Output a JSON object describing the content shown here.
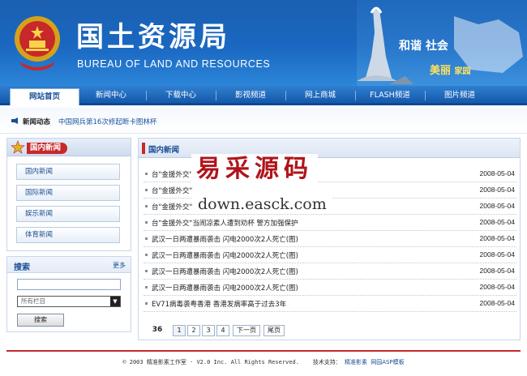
{
  "header": {
    "title_cn": "国土资源局",
    "title_en": "BUREAU OF LAND AND RESOURCES",
    "slogan": {
      "w1": "和谐",
      "w2": "社会",
      "w3": "美丽",
      "w4": "家园"
    }
  },
  "nav": {
    "items": [
      {
        "label": "网站首页",
        "active": true
      },
      {
        "label": "新闻中心"
      },
      {
        "label": "下载中心"
      },
      {
        "label": "影视频道"
      },
      {
        "label": "网上商城"
      },
      {
        "label": "FLASH频道"
      },
      {
        "label": "图片频道"
      }
    ]
  },
  "ticker": {
    "label": "新闻动态",
    "text": "中国网兵第16次修起断卡图林杯"
  },
  "sidebar": {
    "header": "国内新闻",
    "items": [
      "国内新闻",
      "国际新闻",
      "娱乐新闻",
      "体育新闻"
    ]
  },
  "search": {
    "title": "搜索",
    "more": "更多",
    "select_value": "所有栏目",
    "button": "搜索"
  },
  "main": {
    "header": "国内新闻",
    "rows": [
      {
        "title": "台\"金援外交\"",
        "date": "2008-05-04"
      },
      {
        "title": "台\"金援外交\"",
        "date": "2008-05-04"
      },
      {
        "title": "台\"金援外交\"",
        "date": "2008-05-04"
      },
      {
        "title": "台\"金援外交\"当闹凉素人遭到劝杯 警方加强保护",
        "date": "2008-05-04"
      },
      {
        "title": "武汉一日两遭暴雨袭击 闪电2000次2人死亡(图)",
        "date": "2008-05-04"
      },
      {
        "title": "武汉一日两遭暴雨袭击 闪电2000次2人死亡(图)",
        "date": "2008-05-04"
      },
      {
        "title": "武汉一日两遭暴雨袭击 闪电2000次2人死亡(图)",
        "date": "2008-05-04"
      },
      {
        "title": "武汉一日两遭暴雨袭击 闪电2000次2人死亡(图)",
        "date": "2008-05-04"
      },
      {
        "title": "EV71病毒袭粤香港 香港发病率高于过去3年",
        "date": "2008-05-04"
      }
    ],
    "pager": {
      "total": "36",
      "pages": [
        "1",
        "2",
        "3",
        "4"
      ],
      "next": "下一页",
      "last": "尾页"
    }
  },
  "watermark": {
    "cn": "易采源码",
    "en": "down.easck.com"
  },
  "footer": {
    "copyright": "© 2003 精准影素工作室 · V2.0 Inc. All Rights Reserved.",
    "support_label": "技术支持：",
    "support_link": "精准影素",
    "template_link": "网园ASP模板"
  },
  "colors": {
    "brand_blue": "#1a5fb4",
    "accent_red": "#c8282a",
    "link_blue": "#1a4e95"
  }
}
